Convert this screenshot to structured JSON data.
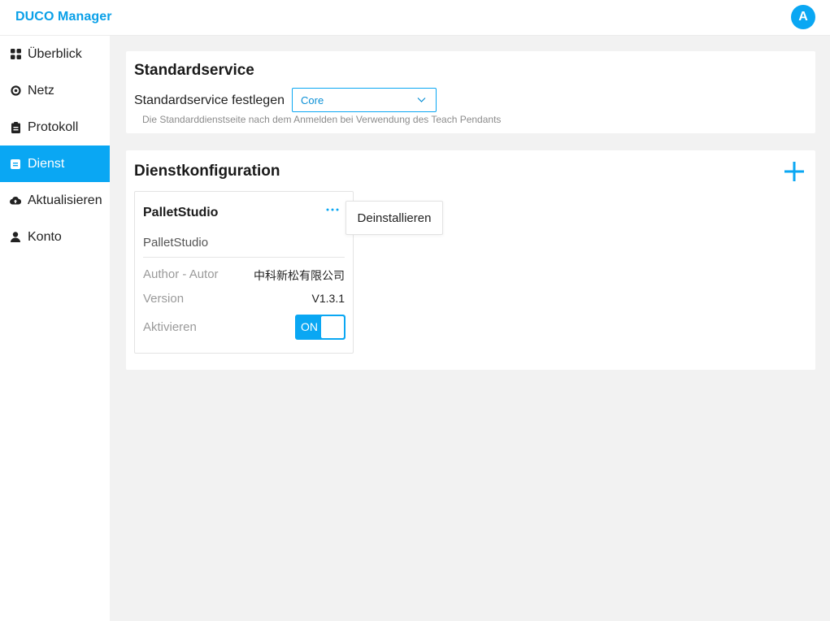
{
  "app": {
    "brand": "DUCO Manager",
    "avatar_letter": "A",
    "accent_color": "#0aa7f3"
  },
  "sidebar": {
    "items": [
      {
        "label": "Überblick",
        "icon": "grid-icon"
      },
      {
        "label": "Netz",
        "icon": "network-icon"
      },
      {
        "label": "Protokoll",
        "icon": "clipboard-icon"
      },
      {
        "label": "Dienst",
        "icon": "service-icon",
        "active": true
      },
      {
        "label": "Aktualisieren",
        "icon": "cloud-upload-icon"
      },
      {
        "label": "Konto",
        "icon": "user-icon"
      }
    ]
  },
  "standard_service": {
    "title": "Standardservice",
    "field_label": "Standardservice festlegen",
    "selected_value": "Core",
    "hint": "Die Standarddienstseite nach dem Anmelden bei Verwendung des Teach Pendants"
  },
  "service_config": {
    "title": "Dienstkonfiguration",
    "add_icon": "plus-icon",
    "services": [
      {
        "name": "PalletStudio",
        "description": "PalletStudio",
        "author_label": "Author - Autor",
        "author_value": "中科新松有限公司",
        "version_label": "Version",
        "version_value": "V1.3.1",
        "activate_label": "Aktivieren",
        "toggle_label": "ON",
        "enabled": true
      }
    ],
    "menu": {
      "uninstall_label": "Deinstallieren"
    }
  }
}
